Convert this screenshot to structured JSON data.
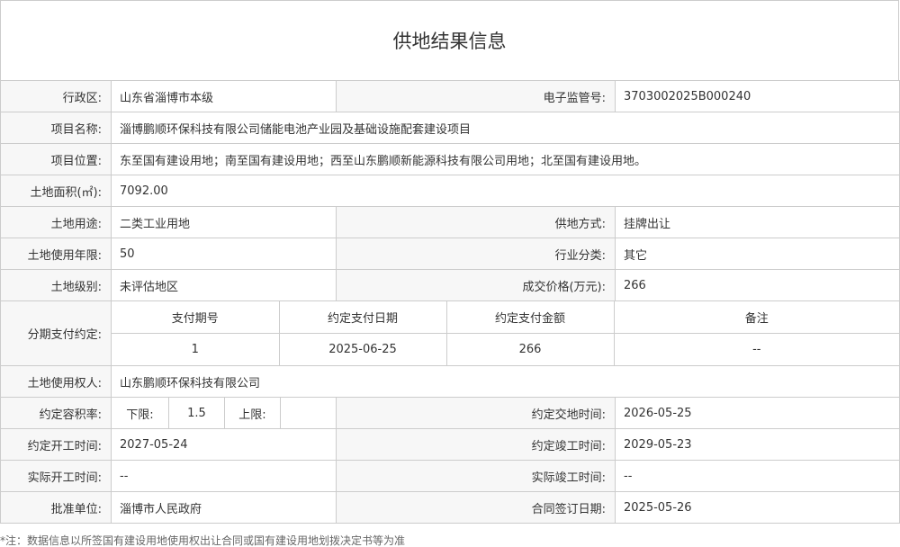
{
  "title": "供地结果信息",
  "labels": {
    "region": "行政区:",
    "supervision_no": "电子监管号:",
    "project_name": "项目名称:",
    "project_location": "项目位置:",
    "land_area": "土地面积(㎡):",
    "land_use": "土地用途:",
    "supply_method": "供地方式:",
    "use_years": "土地使用年限:",
    "industry": "行业分类:",
    "land_grade": "土地级别:",
    "deal_price": "成交价格(万元):",
    "installment": "分期支付约定:",
    "land_owner": "土地使用权人:",
    "far": "约定容积率:",
    "handover_date": "约定交地时间:",
    "start_date": "约定开工时间:",
    "completion_date": "约定竣工时间:",
    "actual_start": "实际开工时间:",
    "actual_completion": "实际竣工时间:",
    "approver": "批准单位:",
    "contract_date": "合同签订日期:"
  },
  "values": {
    "region": "山东省淄博市本级",
    "supervision_no": "3703002025B000240",
    "project_name": "淄博鹏顺环保科技有限公司储能电池产业园及基础设施配套建设项目",
    "project_location": "东至国有建设用地；南至国有建设用地；西至山东鹏顺新能源科技有限公司用地；北至国有建设用地。",
    "land_area": "7092.00",
    "land_use": "二类工业用地",
    "supply_method": "挂牌出让",
    "use_years": "50",
    "industry": "其它",
    "land_grade": "未评估地区",
    "deal_price": "266",
    "land_owner": "山东鹏顺环保科技有限公司",
    "far_lower_label": "下限:",
    "far_lower": "1.5",
    "far_upper_label": "上限:",
    "far_upper": "",
    "handover_date": "2026-05-25",
    "start_date": "2027-05-24",
    "completion_date": "2029-05-23",
    "actual_start": "--",
    "actual_completion": "--",
    "approver": "淄博市人民政府",
    "contract_date": "2025-05-26"
  },
  "installment": {
    "headers": [
      "支付期号",
      "约定支付日期",
      "约定支付金额",
      "备注"
    ],
    "rows": [
      [
        "1",
        "2025-06-25",
        "266",
        "--"
      ]
    ]
  },
  "footnote": "*注：数据信息以所签国有建设用地使用权出让合同或国有建设用地划拨决定书等为准"
}
